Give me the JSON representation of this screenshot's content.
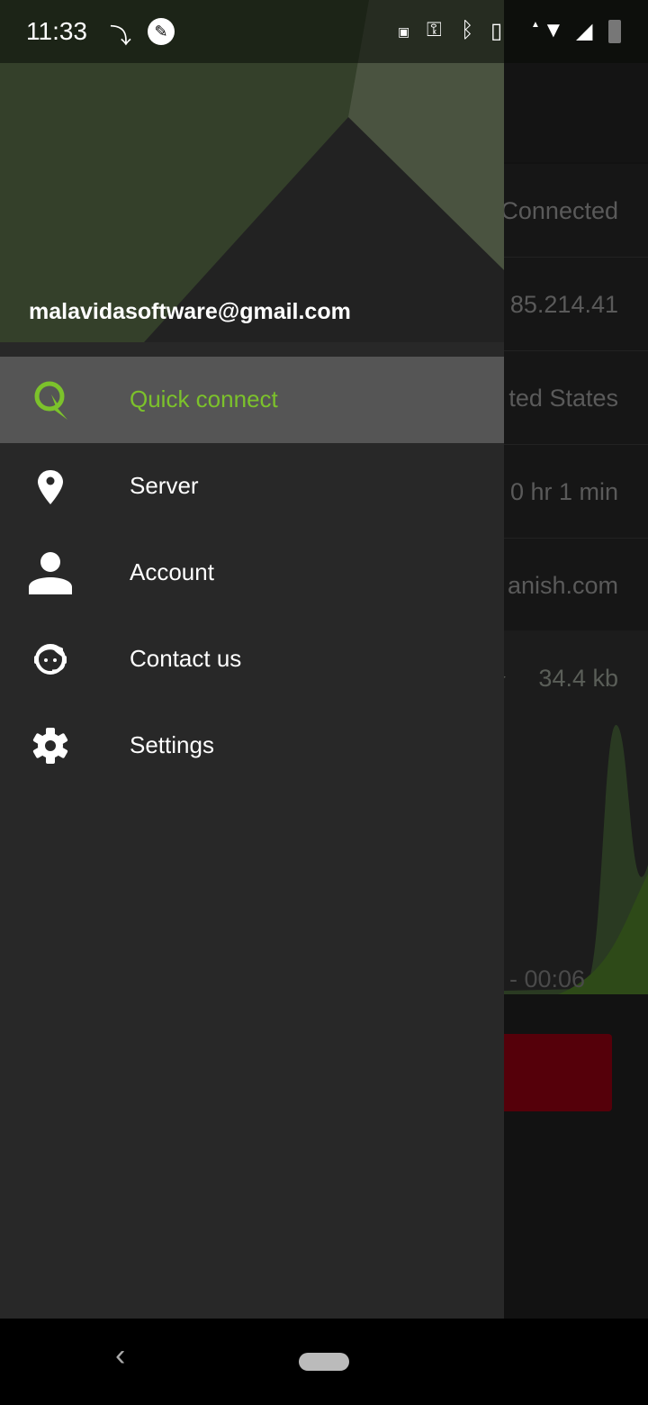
{
  "status_bar": {
    "time": "11:33",
    "icons": [
      "pip-icon",
      "screenshot-icon",
      "cast-icon",
      "vpn-key-icon",
      "bluetooth-icon",
      "vibrate-icon",
      "wifi-icon",
      "signal-icon",
      "battery-charging-icon"
    ]
  },
  "drawer": {
    "email": "malavidasoftware@gmail.com",
    "items": [
      {
        "label": "Quick connect",
        "icon": "quick-connect-icon",
        "selected": true
      },
      {
        "label": "Server",
        "icon": "location-pin-icon"
      },
      {
        "label": "Account",
        "icon": "person-icon"
      },
      {
        "label": "Contact us",
        "icon": "support-agent-icon"
      },
      {
        "label": "Settings",
        "icon": "gear-icon"
      }
    ]
  },
  "background": {
    "rows": [
      "Connected",
      "85.214.41",
      "ted States",
      "0 hr 1 min",
      "anish.com"
    ],
    "traffic": "34.4 kb",
    "time": "- 00:06"
  },
  "colors": {
    "accent": "#7cc22b",
    "disconnect_button": "#55000a"
  }
}
